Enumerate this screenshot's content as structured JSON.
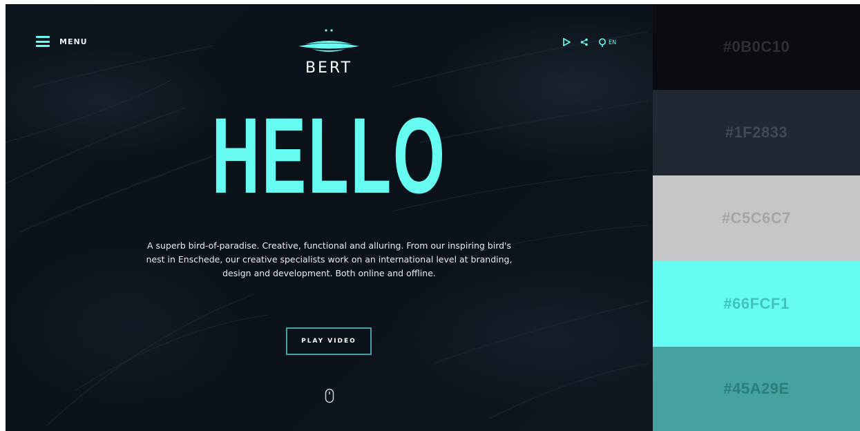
{
  "hero": {
    "menu_label": "MENU",
    "logo_text": "BERT",
    "language": "EN",
    "headline": "HELLO",
    "description": "A superb bird-of-paradise. Creative, functional and alluring. From our inspiring bird's nest in Enschede, our creative specialists work on an international level at branding, design and development. Both online and offline.",
    "play_button_label": "PLAY VIDEO",
    "accent_color": "#66FCF1",
    "icons": [
      "menu-icon",
      "bird-logo-icon",
      "play-icon",
      "share-icon",
      "language-icon",
      "mouse-scroll-icon"
    ]
  },
  "palette": {
    "swatches": [
      {
        "hex": "#0B0C10",
        "bg": "#0B0C10",
        "text_color": "#2b3036"
      },
      {
        "hex": "#1F2833",
        "bg": "#1F2833",
        "text_color": "#3e4a57"
      },
      {
        "hex": "#C5C6C7",
        "bg": "#C5C6C7",
        "text_color": "#a4a5a7"
      },
      {
        "hex": "#66FCF1",
        "bg": "#66FCF1",
        "text_color": "#40c3b9"
      },
      {
        "hex": "#45A29E",
        "bg": "#45A29E",
        "text_color": "#2d7d79"
      }
    ]
  }
}
